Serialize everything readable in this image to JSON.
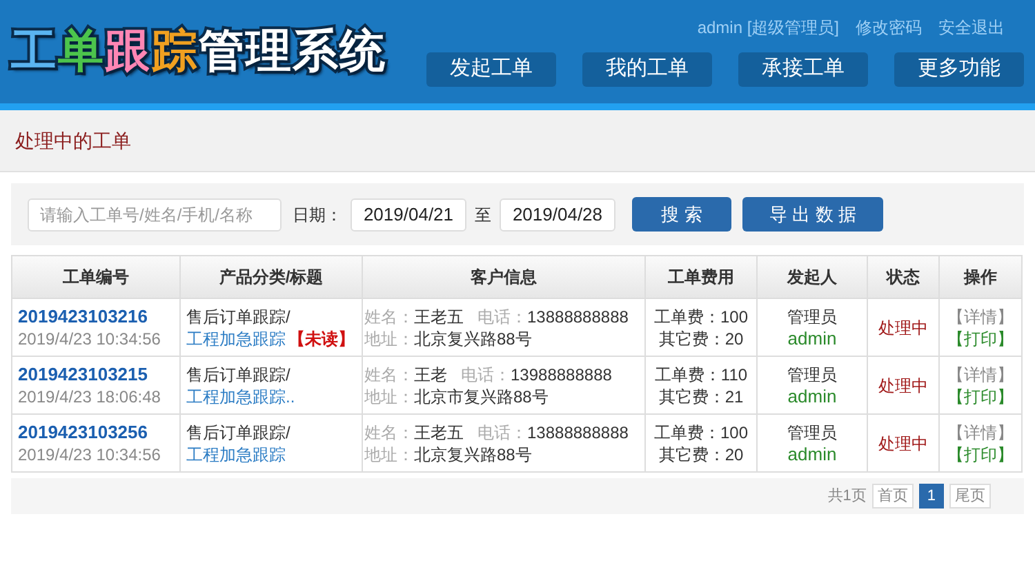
{
  "header": {
    "logo": [
      {
        "text": "工",
        "color": "#5ab4f0"
      },
      {
        "text": "单",
        "color": "#4cc44c"
      },
      {
        "text": "跟",
        "color": "#ff86b4"
      },
      {
        "text": "踪",
        "color": "#f0a020"
      },
      {
        "text": "管理系统",
        "color": "#ffffff"
      }
    ],
    "user_links": [
      "admin [超级管理员]",
      "修改密码",
      "安全退出"
    ],
    "nav": [
      {
        "label": "发起工单",
        "selected": false
      },
      {
        "label": "我的工单",
        "selected": false
      },
      {
        "label": "承接工单",
        "selected": false
      },
      {
        "label": "更多功能",
        "selected": false
      }
    ]
  },
  "page_title": "处理中的工单",
  "filters": {
    "search": {
      "placeholder": "请输入工单号/姓名/手机/名称"
    },
    "date_label": "日期：",
    "date_from": "2019/04/21",
    "to_label": "至",
    "date_to": "2019/04/28",
    "buttons": [
      "搜 索",
      "导 出 数 据"
    ]
  },
  "table": {
    "columns": [
      "工单编号",
      "产品分类/标题",
      "客户信息",
      "工单费用",
      "发起人",
      "状态",
      "操作"
    ],
    "rows": [
      {
        "order_no": "2019423103216",
        "time": "2019/4/23 10:34:56",
        "category": "售后订单跟踪/",
        "title": "工程加急跟踪",
        "unread": "【未读】",
        "name_label": "姓名：",
        "name": "王老五",
        "phone_label": "电话：",
        "phone": "13888888888",
        "address_label": "地址：",
        "address": "北京复兴路88号",
        "fee": "工单费：100",
        "other_fee": "其它费：20",
        "role": "管理员",
        "user": "admin",
        "status": "处理中",
        "actions": [
          "【详情】",
          "【打印】"
        ]
      },
      {
        "order_no": "2019423103215",
        "time": "2019/4/23 18:06:48",
        "category": "售后订单跟踪/",
        "title": "工程加急跟踪..",
        "name_label": "姓名：",
        "name": "王老",
        "phone_label": "电话：",
        "phone": "13988888888",
        "address_label": "地址：",
        "address": "北京市复兴路88号",
        "fee": "工单费：110",
        "other_fee": "其它费：21",
        "role": "管理员",
        "user": "admin",
        "status": "处理中",
        "actions": [
          "【详情】",
          "【打印】"
        ]
      },
      {
        "order_no": "2019423103256",
        "time": "2019/4/23 10:34:56",
        "category": "售后订单跟踪/",
        "title": "工程加急跟踪",
        "name_label": "姓名：",
        "name": "王老五",
        "phone_label": "电话：",
        "phone": "13888888888",
        "address_label": "地址：",
        "address": "北京复兴路88号",
        "fee": "工单费：100",
        "other_fee": "其它费：20",
        "role": "管理员",
        "user": "admin",
        "status": "处理中",
        "actions": [
          "【详情】",
          "【打印】"
        ]
      }
    ]
  },
  "pager": {
    "total": "共1页",
    "first": "首页",
    "pages": [
      {
        "label": "1",
        "selected": true
      }
    ],
    "last": "尾页"
  }
}
